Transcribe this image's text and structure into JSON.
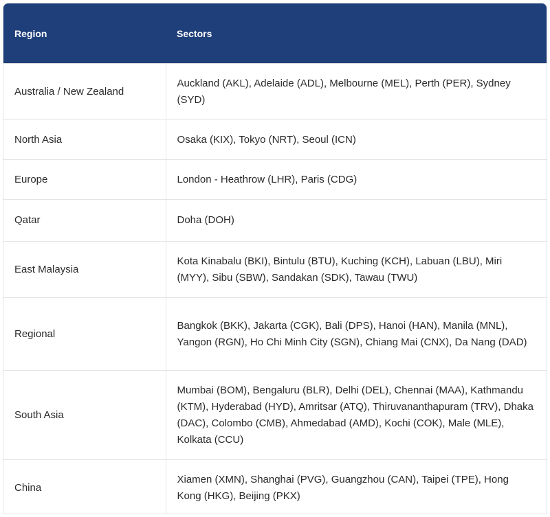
{
  "table": {
    "headers": [
      "Region",
      "Sectors"
    ],
    "rows": [
      {
        "region": "Australia / New Zealand",
        "sectors": "Auckland (AKL), Adelaide (ADL), Melbourne (MEL), Perth (PER), Sydney (SYD)"
      },
      {
        "region": "North Asia",
        "sectors": "Osaka (KIX), Tokyo (NRT), Seoul (ICN)"
      },
      {
        "region": "Europe",
        "sectors": "London - Heathrow (LHR), Paris (CDG)"
      },
      {
        "region": "Qatar",
        "sectors": "Doha (DOH)"
      },
      {
        "region": "East Malaysia",
        "sectors": "Kota Kinabalu (BKI), Bintulu (BTU), Kuching (KCH), Labuan (LBU), Miri (MYY), Sibu (SBW), Sandakan (SDK), Tawau (TWU)"
      },
      {
        "region": "Regional",
        "sectors": "Bangkok (BKK), Jakarta (CGK), Bali (DPS), Hanoi (HAN), Manila (MNL), Yangon (RGN), Ho Chi Minh City (SGN), Chiang Mai (CNX), Da Nang (DAD)"
      },
      {
        "region": "South Asia",
        "sectors": "Mumbai (BOM), Bengaluru (BLR), Delhi (DEL), Chennai (MAA), Kathmandu (KTM), Hyderabad (HYD), Amritsar (ATQ), Thiruvananthapuram (TRV), Dhaka (DAC), Colombo (CMB), Ahmedabad (AMD), Kochi (COK), Male (MLE), Kolkata (CCU)"
      },
      {
        "region": "China",
        "sectors": "Xiamen (XMN), Shanghai (PVG), Guangzhou (CAN), Taipei (TPE), Hong Kong (HKG), Beijing (PKX)"
      }
    ]
  },
  "colors": {
    "header_bg": "#1f3f7a",
    "header_text": "#ffffff",
    "body_text": "#2a2a2a",
    "border": "#e4e4e4"
  }
}
